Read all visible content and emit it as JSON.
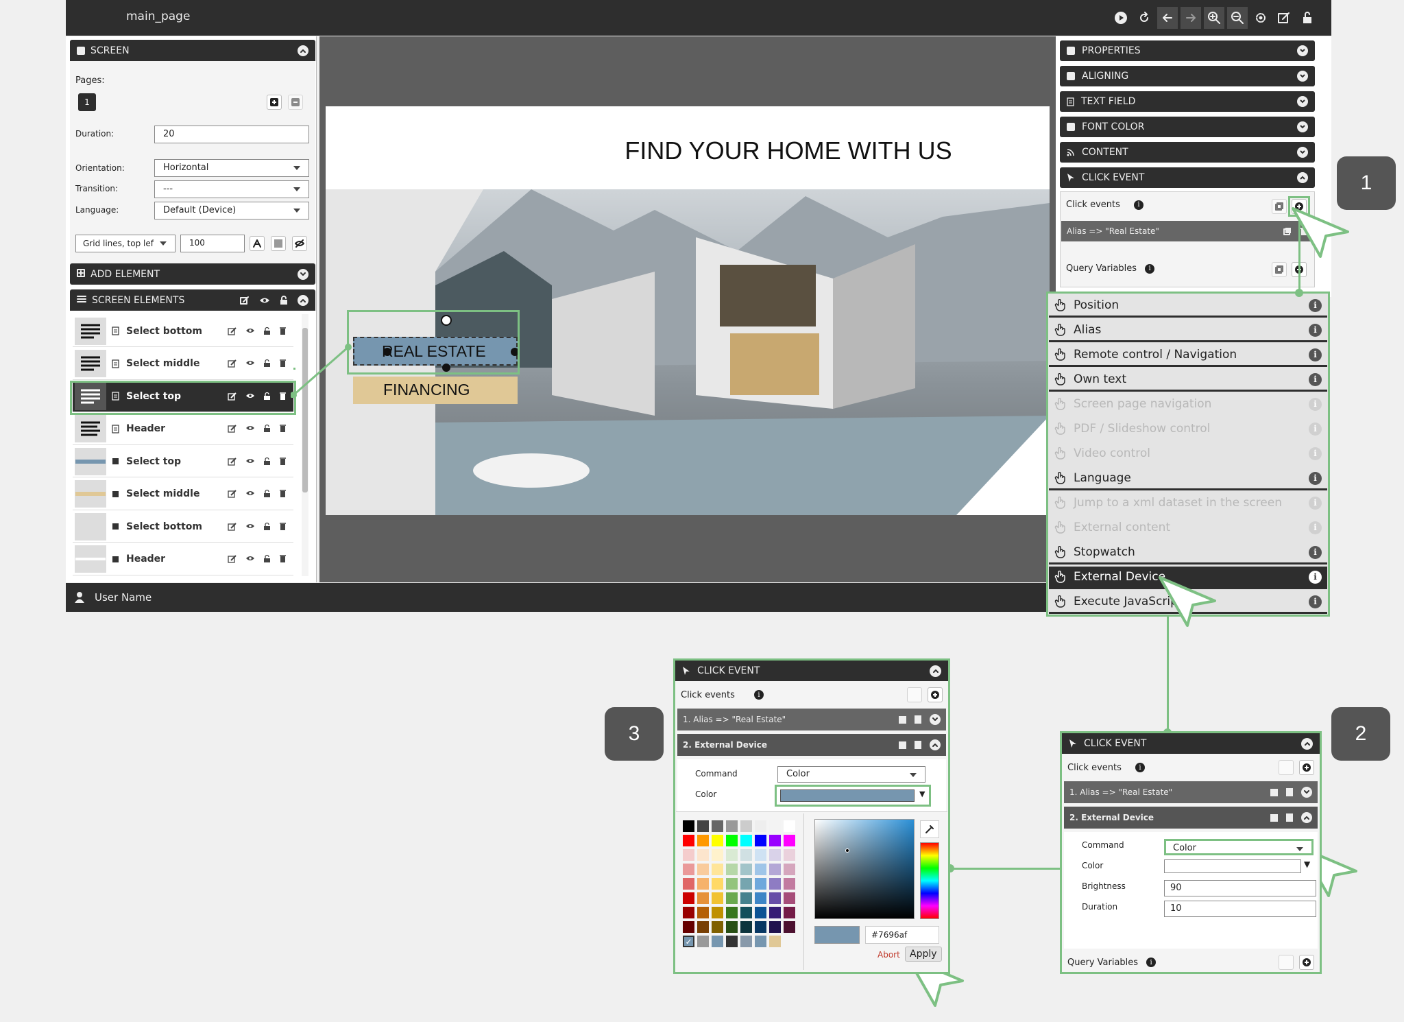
{
  "app": {
    "page_title": "main_page",
    "user_name": "User Name"
  },
  "screen_panel": {
    "title": "SCREEN",
    "pages_label": "Pages:",
    "page_number": "1",
    "duration_label": "Duration:",
    "duration_value": "20",
    "orientation_label": "Orientation:",
    "orientation_value": "Horizontal",
    "transition_label": "Transition:",
    "transition_value": "---",
    "language_label": "Language:",
    "language_value": "Default (Device)",
    "grid_value": "Grid lines, top lef",
    "grid_size": "100"
  },
  "add_element": {
    "title": "ADD ELEMENT"
  },
  "screen_elements": {
    "title": "SCREEN ELEMENTS",
    "items": [
      {
        "label": "Select bottom",
        "kind": "text"
      },
      {
        "label": "Select middle",
        "kind": "text"
      },
      {
        "label": "Select top",
        "kind": "text"
      },
      {
        "label": "Header",
        "kind": "text"
      },
      {
        "label": "Select top",
        "kind": "shape"
      },
      {
        "label": "Select middle",
        "kind": "shape"
      },
      {
        "label": "Select bottom",
        "kind": "shape"
      },
      {
        "label": "Header",
        "kind": "shape"
      }
    ]
  },
  "slide": {
    "headline": "FIND YOUR HOME WITH US",
    "button_top": "REAL ESTATE",
    "button_middle": "FINANCING",
    "color_top": "#7696af",
    "color_middle": "#e0c896"
  },
  "right_panel": {
    "sections": [
      "PROPERTIES",
      "ALIGNING",
      "TEXT FIELD",
      "FONT COLOR",
      "CONTENT",
      "CLICK EVENT"
    ],
    "click_events_label": "Click events",
    "alias_entry": "Alias => \"Real Estate\"",
    "query_variables_label": "Query Variables"
  },
  "action_menu": [
    {
      "label": "Position",
      "enabled": true
    },
    {
      "label": "Alias",
      "enabled": true
    },
    {
      "label": "Remote control / Navigation",
      "enabled": true
    },
    {
      "label": "Own text",
      "enabled": true
    },
    {
      "label": "Screen page navigation",
      "enabled": false
    },
    {
      "label": "PDF / Slideshow control",
      "enabled": false
    },
    {
      "label": "Video control",
      "enabled": false
    },
    {
      "label": "Language",
      "enabled": true
    },
    {
      "label": "Jump to a xml dataset in the screen",
      "enabled": false
    },
    {
      "label": "External content",
      "enabled": false
    },
    {
      "label": "Stopwatch",
      "enabled": true
    },
    {
      "label": "External Device",
      "enabled": true
    },
    {
      "label": "Execute JavaScript",
      "enabled": true
    }
  ],
  "steps": {
    "one": "1",
    "two": "2",
    "three": "3"
  },
  "popup2": {
    "title": "CLICK EVENT",
    "click_events_label": "Click events",
    "event1": "1.   Alias => \"Real Estate\"",
    "event2": "2.   External Device",
    "command_label": "Command",
    "command_value": "Color",
    "color_label": "Color",
    "brightness_label": "Brightness",
    "brightness_value": "90",
    "duration_label": "Duration",
    "duration_value": "10",
    "query_variables_label": "Query Variables"
  },
  "popup3": {
    "title": "CLICK EVENT",
    "click_events_label": "Click events",
    "event1": "1.   Alias => \"Real Estate\"",
    "event2": "2.   External Device",
    "command_label": "Command",
    "command_value": "Color",
    "color_label": "Color",
    "hex_value": "#7696af",
    "abort_label": "Abort",
    "apply_label": "Apply"
  },
  "colors": {
    "accent_green": "#7dc083",
    "dark": "#2e2e2e",
    "selected_color": "#7696af"
  }
}
